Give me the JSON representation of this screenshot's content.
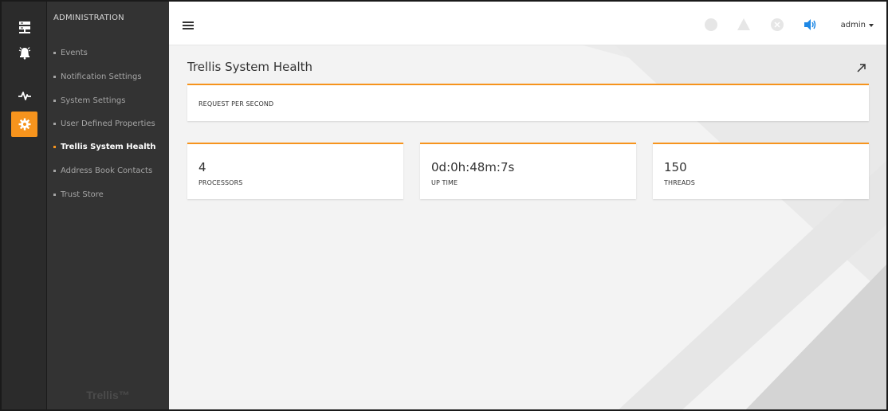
{
  "rail": {
    "items": [
      {
        "icon": "server-icon",
        "active": false
      },
      {
        "icon": "alarm-bell-icon",
        "active": false
      },
      {
        "icon": "pulse-icon",
        "active": false
      },
      {
        "icon": "gear-icon",
        "active": true
      }
    ]
  },
  "submenu": {
    "title": "ADMINISTRATION",
    "items": [
      {
        "label": "Events",
        "active": false
      },
      {
        "label": "Notification Settings",
        "active": false
      },
      {
        "label": "System Settings",
        "active": false
      },
      {
        "label": "User Defined Properties",
        "active": false
      },
      {
        "label": "Trellis System Health",
        "active": true
      },
      {
        "label": "Address Book Contacts",
        "active": false
      },
      {
        "label": "Trust Store",
        "active": false
      }
    ],
    "brand": "Trellis™"
  },
  "topbar": {
    "icons": [
      "circle-status-icon",
      "warning-triangle-icon",
      "close-circle-icon",
      "speaker-icon"
    ],
    "user": "admin"
  },
  "page": {
    "title": "Trellis System Health",
    "rps_label": "REQUEST PER SECOND",
    "stats": [
      {
        "value": "4",
        "label": "PROCESSORS"
      },
      {
        "value": "0d:0h:48m:7s",
        "label": "UP TIME"
      },
      {
        "value": "150",
        "label": "THREADS"
      }
    ]
  },
  "colors": {
    "accent": "#f7941d",
    "rail_bg": "#2b2b2b",
    "submenu_bg": "#333333",
    "content_bg": "#f3f3f3",
    "speaker": "#1e88e5"
  }
}
